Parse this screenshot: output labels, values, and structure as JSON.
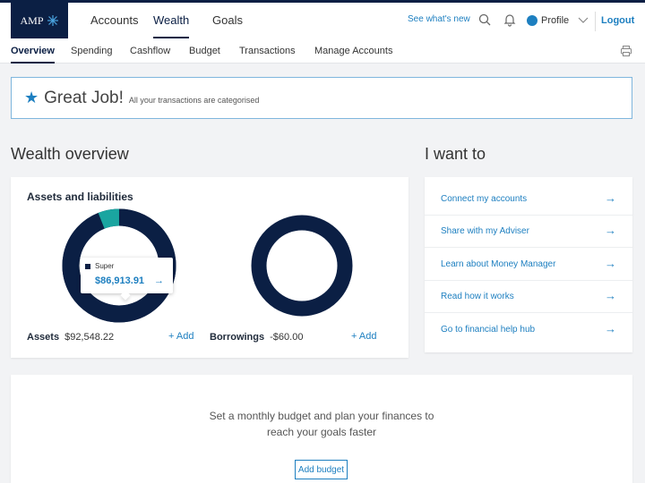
{
  "brand": {
    "logo_text": "AMP"
  },
  "topnav": {
    "tabs": [
      "Accounts",
      "Wealth",
      "Goals"
    ],
    "active": "Wealth",
    "whats_new": "See what's new",
    "profile": "Profile",
    "logout": "Logout"
  },
  "subnav": {
    "tabs": [
      "Overview",
      "Spending",
      "Cashflow",
      "Budget",
      "Transactions",
      "Manage Accounts"
    ],
    "active": "Overview"
  },
  "banner": {
    "title": "Great Job!",
    "subtitle": "All your transactions are categorised"
  },
  "wealth": {
    "title": "Wealth overview",
    "card_title": "Assets and liabilities",
    "assets": {
      "label": "Assets",
      "value": "$92,548.22",
      "add": "+ Add",
      "super_fraction": 0.94
    },
    "borrowings": {
      "label": "Borrowings",
      "value": "-$60.00",
      "add": "+ Add"
    },
    "tooltip": {
      "label": "Super",
      "value": "$86,913.91"
    }
  },
  "want": {
    "title": "I want to",
    "items": [
      "Connect my accounts",
      "Share with my Adviser",
      "Learn about Money Manager",
      "Read how it works",
      "Go to financial help hub"
    ]
  },
  "budget": {
    "line1": "Set a monthly budget and plan your finances to",
    "line2": "reach your goals faster",
    "button": "Add budget"
  },
  "colors": {
    "navy": "#0b1f44",
    "teal": "#1aa5a0",
    "link": "#1d7fc0"
  },
  "icons": [
    "search-icon",
    "bell-icon",
    "chevron-down-icon",
    "print-icon",
    "star-icon",
    "arrow-right-icon"
  ]
}
